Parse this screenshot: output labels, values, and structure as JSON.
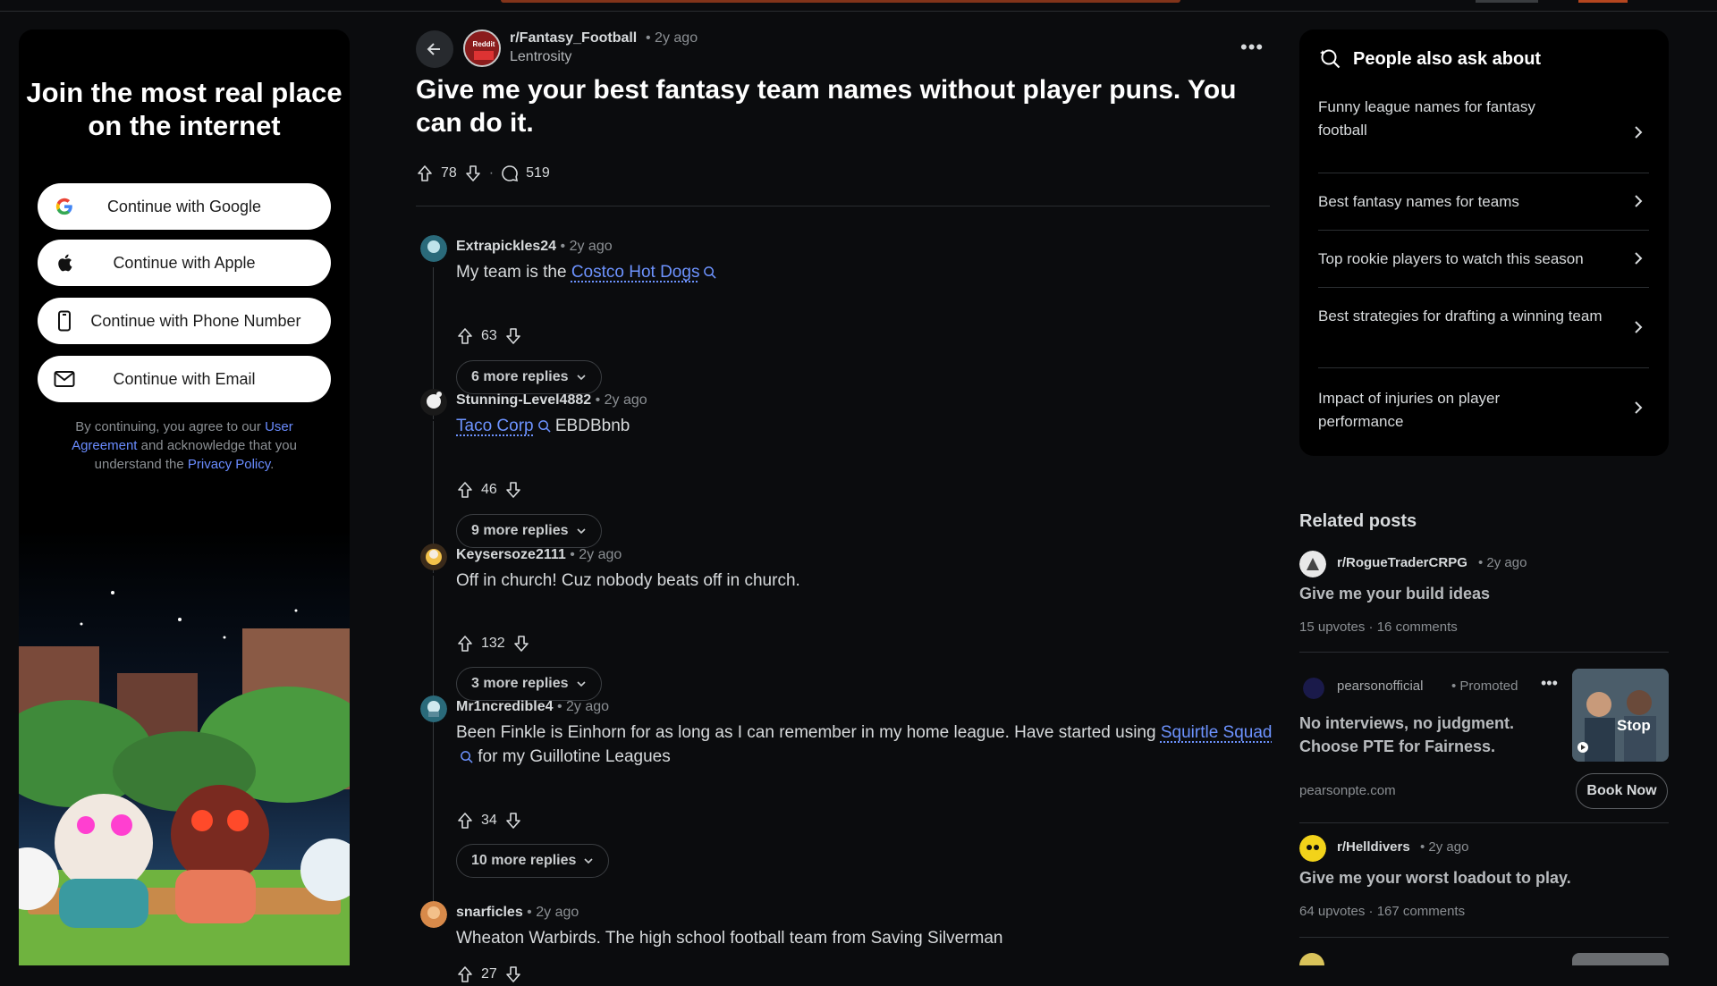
{
  "login": {
    "heading": "Join the most real place on the internet",
    "google": "Continue with Google",
    "apple": "Continue with Apple",
    "phone": "Continue with Phone Number",
    "email": "Continue with Email",
    "legal_prefix": "By continuing, you agree to our ",
    "legal_link1": "User Agreement",
    "legal_mid": " and acknowledge that you understand the ",
    "legal_link2": "Privacy Policy",
    "legal_suffix": "."
  },
  "post": {
    "subreddit": "r/Fantasy_Football",
    "time": "• 2y ago",
    "author": "Lentrosity",
    "title": "Give me your best fantasy team names without player puns. You can do it.",
    "upvotes": "78",
    "comments": "519"
  },
  "comments": [
    {
      "author": "Extrapickles24",
      "time": "• 2y ago",
      "prefix": "My team is the ",
      "link": "Costco Hot Dogs",
      "suffix": "",
      "votes": "63",
      "more": "6 more replies"
    },
    {
      "author": "Stunning-Level4882",
      "time": "• 2y ago",
      "prefix": "",
      "link": "Taco Corp",
      "suffix": " EBDBbnb",
      "votes": "46",
      "more": "9 more replies"
    },
    {
      "author": "Keysersoze2111",
      "time": "• 2y ago",
      "prefix": "Off in church! Cuz nobody beats off in church.",
      "link": "",
      "suffix": "",
      "votes": "132",
      "more": "3 more replies"
    },
    {
      "author": "Mr1ncredible4",
      "time": "• 2y ago",
      "prefix": "Been Finkle is Einhorn for as long as I can remember in my home league. Have started using ",
      "link": "Squirtle Squad",
      "suffix": " for my Guillotine Leagues",
      "votes": "34",
      "more": "10 more replies"
    },
    {
      "author": "snarficles",
      "time": "• 2y ago",
      "prefix": "Wheaton Warbirds. The high school football team from Saving Silverman",
      "link": "",
      "suffix": "",
      "votes": "27",
      "more": ""
    }
  ],
  "ask": {
    "heading": "People also ask about",
    "items": [
      "Funny league names for fantasy football",
      "Best fantasy names for teams",
      "Top rookie players to watch this season",
      "Best strategies for drafting a winning team",
      "Impact of injuries on player performance"
    ]
  },
  "related": {
    "heading": "Related posts",
    "post1": {
      "sub": "r/RogueTraderCRPG",
      "time": "• 2y ago",
      "title": "Give me your build ideas",
      "meta": "15 upvotes · 16 comments"
    },
    "promo": {
      "sub": "pearsonofficial",
      "tag": "• Promoted",
      "title": "No interviews, no judgment. Choose PTE for Fairness.",
      "domain": "pearsonpte.com",
      "cta": "Book Now",
      "thumb_text": "Stop"
    },
    "post2": {
      "sub": "r/Helldivers",
      "time": "• 2y ago",
      "title": "Give me your worst loadout to play.",
      "meta": "64 upvotes · 167 comments"
    }
  },
  "colors": {
    "background": "#0b0c0e",
    "link": "#6d93ff",
    "card": "#000000"
  }
}
